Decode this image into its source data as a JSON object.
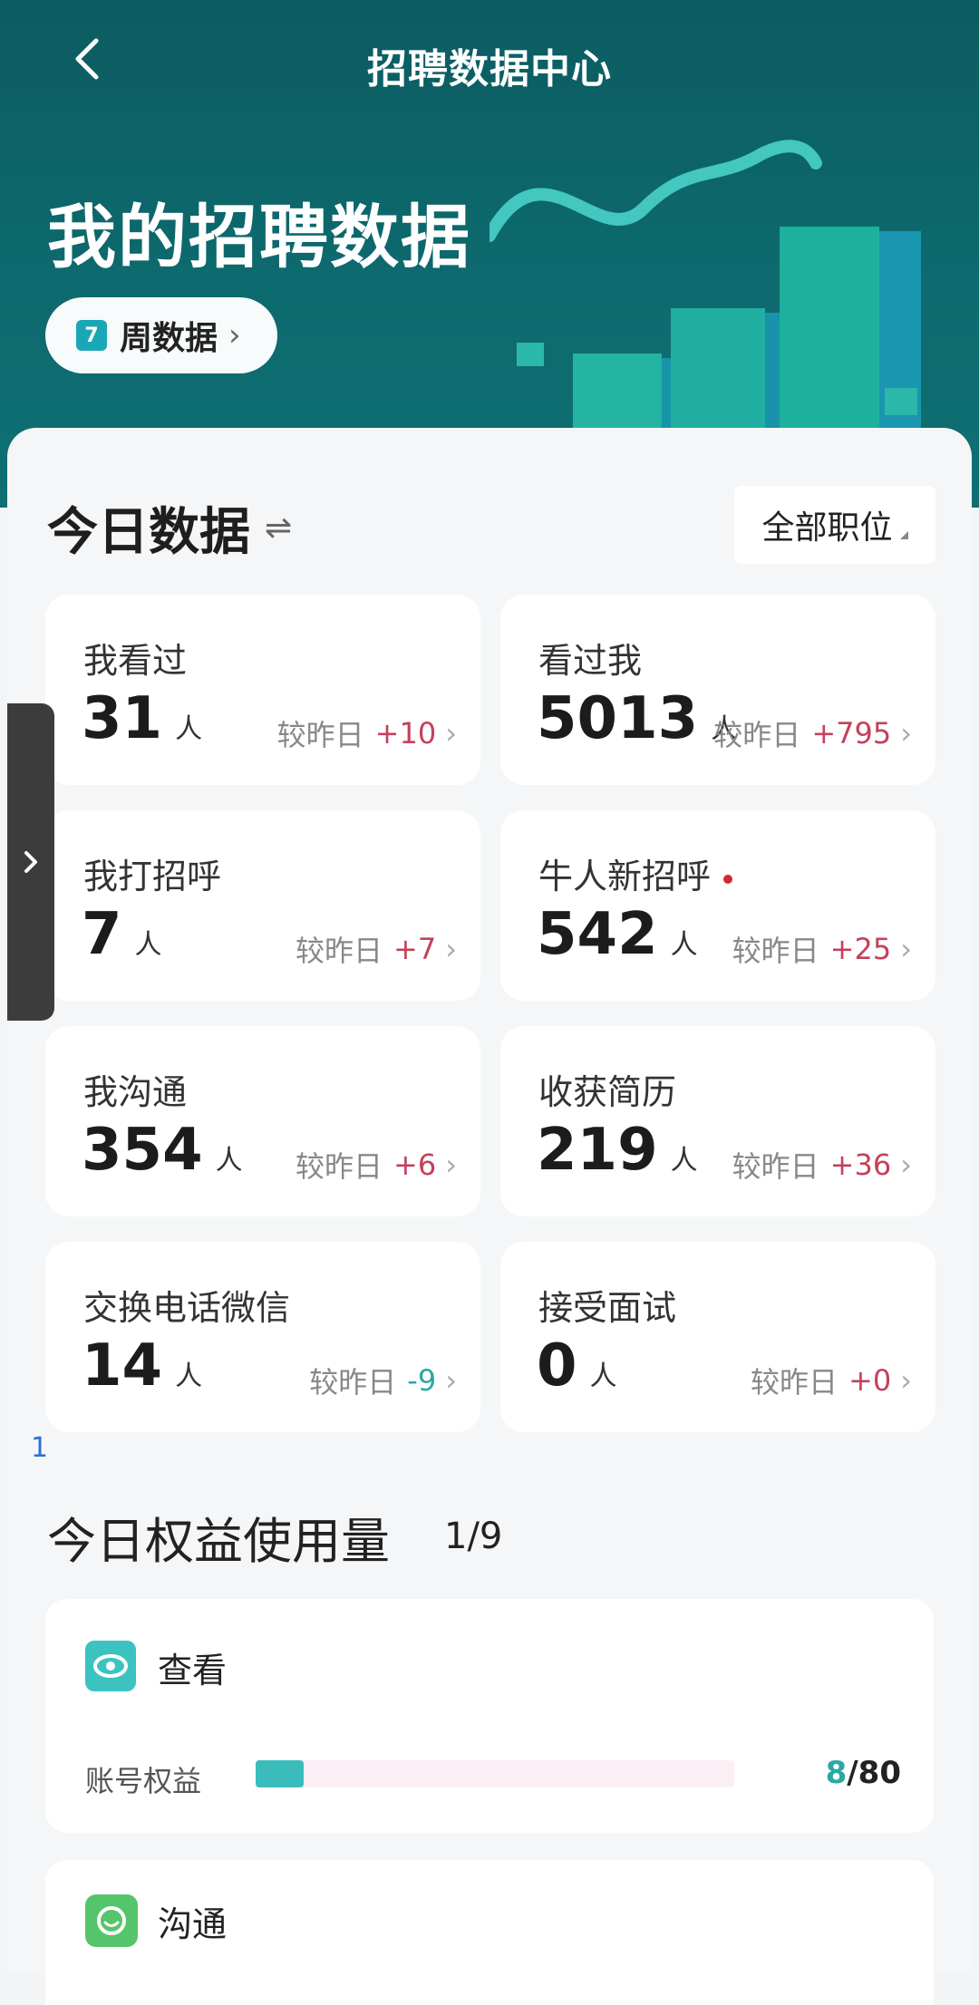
{
  "nav": {
    "title": "招聘数据中心"
  },
  "hero": {
    "title": "我的招聘数据",
    "period_label": "周数据",
    "calendar_day": "7"
  },
  "today": {
    "title": "今日数据",
    "position_filter": "全部职位",
    "compare_label": "较昨日",
    "unit": "人",
    "cards": [
      {
        "label": "我看过",
        "value": "31",
        "delta": "+10"
      },
      {
        "label": "看过我",
        "value": "5013",
        "delta": "+795"
      },
      {
        "label": "我打招呼",
        "value": "7",
        "delta": "+7"
      },
      {
        "label": "牛人新招呼",
        "value": "542",
        "delta": "+25"
      },
      {
        "label": "我沟通",
        "value": "354",
        "delta": "+6"
      },
      {
        "label": "收获简历",
        "value": "219",
        "delta": "+36"
      },
      {
        "label": "交换电话微信",
        "value": "14",
        "delta": "-9"
      },
      {
        "label": "接受面试",
        "value": "0",
        "delta": "+0"
      }
    ]
  },
  "rights": {
    "title": "今日权益使用量",
    "view": {
      "name": "查看",
      "row_label": "账号权益",
      "used": "8",
      "total": "/80",
      "fraction": 0.1
    },
    "communicate": {
      "name": "沟通",
      "side_number": "1"
    }
  },
  "pager": {
    "text": "1/9"
  },
  "colors": {
    "header": "#0d6a6e",
    "accent": "#3bbcbc",
    "positive": "#c4415b",
    "negative": "#2aa9a3"
  }
}
